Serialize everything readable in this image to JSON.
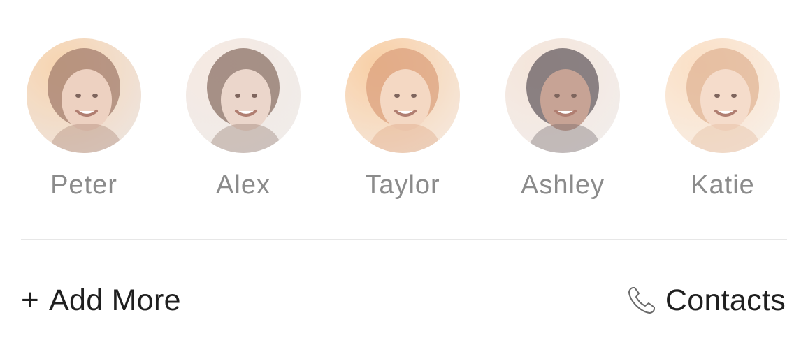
{
  "favorites": [
    {
      "name": "Peter",
      "avatar_bg": "#e9ddd6",
      "hair": "#8a5a44",
      "skin": "#e8c4b0",
      "glow": "#f6c99a"
    },
    {
      "name": "Alex",
      "avatar_bg": "#ece7e4",
      "hair": "#6b4a3c",
      "skin": "#e6cbbd",
      "glow": "#f3e4da"
    },
    {
      "name": "Taylor",
      "avatar_bg": "#f3e2d4",
      "hair": "#d2875a",
      "skin": "#f1cdb3",
      "glow": "#f7c28c"
    },
    {
      "name": "Ashley",
      "avatar_bg": "#efe9e6",
      "hair": "#3c3036",
      "skin": "#b88a78",
      "glow": "#f2ded0"
    },
    {
      "name": "Katie",
      "avatar_bg": "#f7ebe1",
      "hair": "#d8a078",
      "skin": "#f3d2bd",
      "glow": "#fad7b5"
    }
  ],
  "actions": {
    "add_more_plus": "+",
    "add_more_label": "Add More",
    "contacts_label": "Contacts",
    "contacts_icon": "phone-icon"
  },
  "colors": {
    "name_text": "#8b8b8b",
    "action_text": "#1f1f1f",
    "divider": "#e7e7e7"
  }
}
